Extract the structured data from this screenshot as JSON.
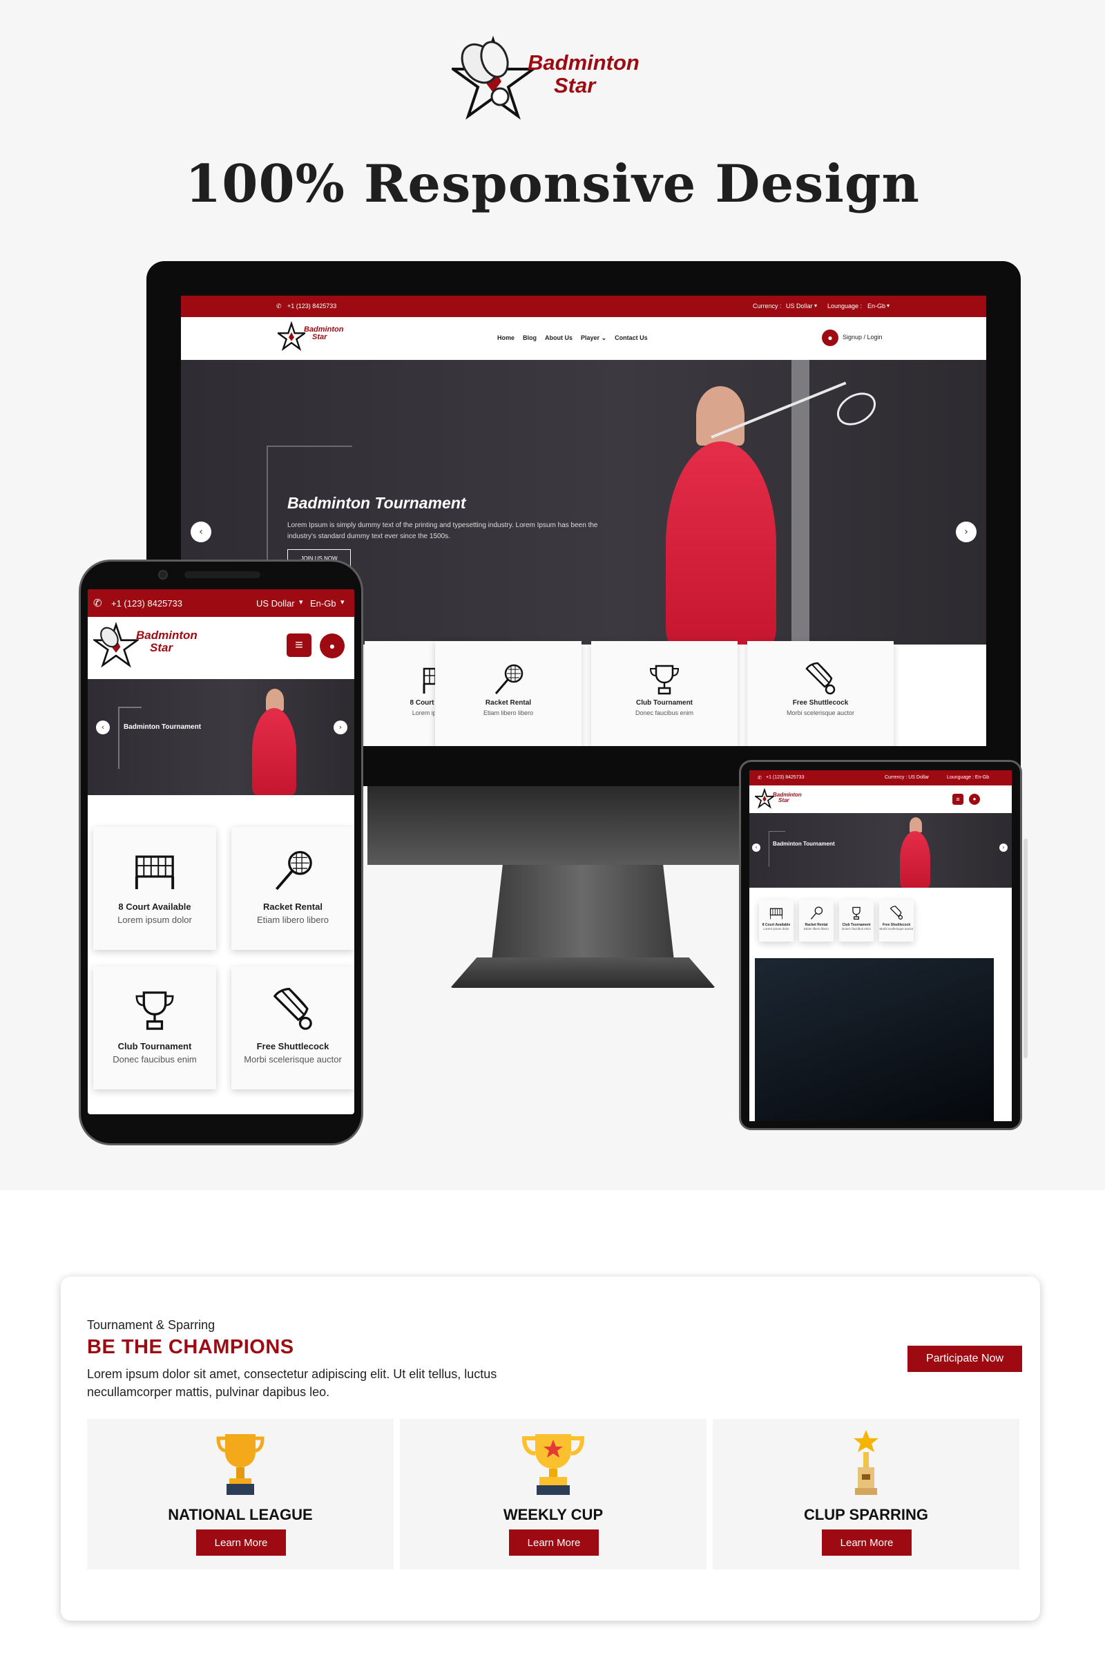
{
  "brand": {
    "line1": "Badminton",
    "line2": "Star"
  },
  "headline": "100% Responsive Design",
  "desktop": {
    "phone": "+1 (123) 8425733",
    "currency_label": "Currency :",
    "currency_value": "US Dollar",
    "language_label": "Lounguage :",
    "language_value": "En-Gb",
    "nav": [
      "Home",
      "Blog",
      "About Us",
      "Player",
      "Contact Us"
    ],
    "signup": "Signup / Login",
    "hero_title": "Badminton Tournament",
    "hero_text": "Lorem Ipsum is simply dummy text of the printing and typesetting industry. Lorem Ipsum has been the industry's standard dummy text ever since the 1500s.",
    "hero_button": "JOIN US NOW",
    "features": [
      {
        "title": "8 Court Available",
        "sub": "Lorem ipsum dolor",
        "icon": "net-icon"
      },
      {
        "title": "Racket Rental",
        "sub": "Etiam libero libero",
        "icon": "racket-icon"
      },
      {
        "title": "Club Tournament",
        "sub": "Donec faucibus enim",
        "icon": "trophy-icon"
      },
      {
        "title": "Free Shuttlecock",
        "sub": "Morbi scelerisque auctor",
        "icon": "shuttlecock-icon"
      }
    ]
  },
  "mobile": {
    "phone": "+1 (123) 8425733",
    "currency": "US Dollar",
    "language": "En-Gb",
    "hero_title": "Badminton Tournament"
  },
  "tablet": {
    "phone": "+1 (123) 8425733",
    "currency": "Currency : US Dollar",
    "language": "Lounguage : En-Gb",
    "hero_title": "Badminton Tournament"
  },
  "champions": {
    "kicker": "Tournament & Sparring",
    "title": "BE THE CHAMPIONS",
    "description": "Lorem ipsum dolor sit amet, consectetur adipiscing elit. Ut elit tellus, luctus necullamcorper mattis, pulvinar dapibus leo.",
    "cta": "Participate Now",
    "cards": [
      {
        "name": "NATIONAL LEAGUE",
        "button": "Learn More"
      },
      {
        "name": "WEEKLY CUP",
        "button": "Learn More"
      },
      {
        "name": "CLUP SPARRING",
        "button": "Learn More"
      }
    ]
  },
  "colors": {
    "brand_red": "#9d0a12",
    "trophy_gold": "#f4b400"
  }
}
